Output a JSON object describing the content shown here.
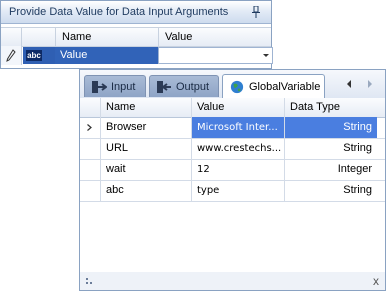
{
  "top_panel": {
    "title": "Provide Data Value for Data Input Arguments",
    "columns": [
      "Name",
      "Value"
    ],
    "row": {
      "type_icon": "abc",
      "name": "Value",
      "value": ""
    }
  },
  "bottom_panel": {
    "tabs": [
      {
        "label": "Input",
        "icon": "input-icon"
      },
      {
        "label": "Output",
        "icon": "output-icon"
      },
      {
        "label": "GlobalVariable",
        "icon": "globe-icon"
      }
    ],
    "columns": [
      "Name",
      "Value",
      "Data Type"
    ],
    "rows": [
      {
        "name": "Browser",
        "value": "Microsoft Inter...",
        "type": "String"
      },
      {
        "name": "URL",
        "value": "www.crestechs...",
        "type": "String"
      },
      {
        "name": "wait",
        "value": "12",
        "type": "Integer"
      },
      {
        "name": "abc",
        "value": "type",
        "type": "String"
      }
    ],
    "close_label": "x"
  },
  "colors": {
    "selection": "#3163b8",
    "row_selection": "#4a7ee0",
    "border": "#8aa2c2"
  }
}
